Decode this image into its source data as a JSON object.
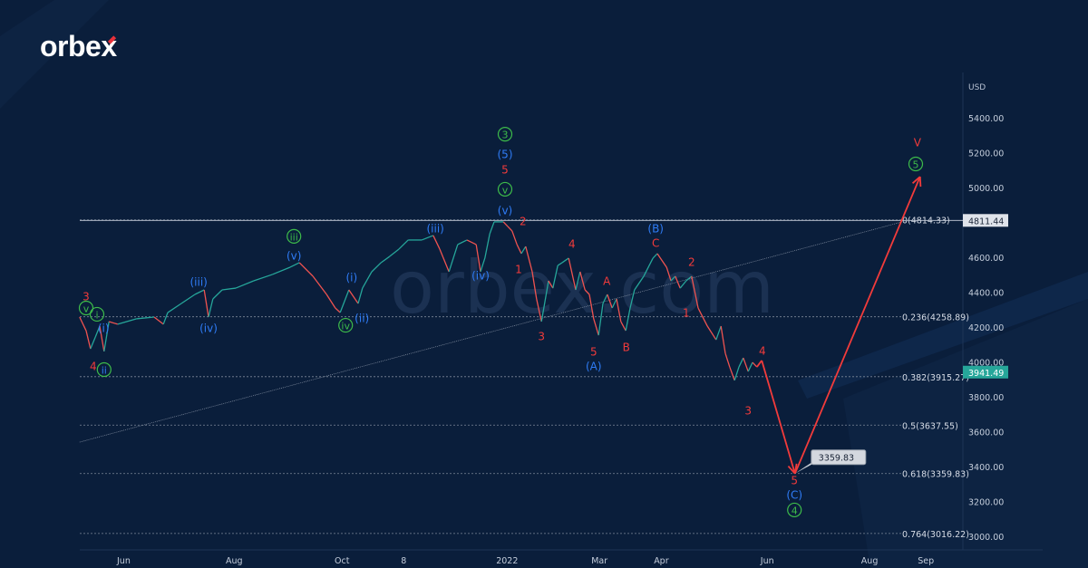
{
  "brand": {
    "logo_text": "orbe",
    "logo_x": "x",
    "watermark": "orbex.com"
  },
  "colors": {
    "background": "#0a1e3b",
    "up": "#26a69a",
    "down": "#ef5350",
    "red": "#f23b3b",
    "blue": "#2f7cf6",
    "green": "#3dbb4a",
    "last_price": "#26a69a"
  },
  "chart_data": {
    "type": "line",
    "title": "",
    "xlabel": "",
    "ylabel": "USD",
    "x_unit": "months since 2021-05-01",
    "ylim": [
      3000,
      5400
    ],
    "xlim": [
      0.18,
      16.3
    ],
    "y_ticks": [
      3000,
      3200,
      3400,
      3600,
      3800,
      4000,
      4200,
      4400,
      4600,
      4800,
      5000,
      5200,
      5400
    ],
    "y_tick_labels": [
      "3000.00",
      "3200.00",
      "3400.00",
      "3600.00",
      "3800.00",
      "4000.00",
      "4200.00",
      "4400.00",
      "4600.00",
      "4800.00",
      "5000.00",
      "5200.00",
      "5400.00"
    ],
    "x_ticks": [
      {
        "m": 1.0,
        "label": "Jun"
      },
      {
        "m": 3.0,
        "label": "Aug"
      },
      {
        "m": 5.0,
        "label": "Oct"
      },
      {
        "m": 6.22,
        "label": "8"
      },
      {
        "m": 7.97,
        "label": "2022"
      },
      {
        "m": 9.72,
        "label": "Mar"
      },
      {
        "m": 10.87,
        "label": "Apr"
      },
      {
        "m": 12.83,
        "label": "Jun"
      },
      {
        "m": 14.68,
        "label": "Aug"
      },
      {
        "m": 15.72,
        "label": "Sep"
      }
    ],
    "series": [
      {
        "name": "Price",
        "points": [
          [
            0.18,
            4257
          ],
          [
            0.3,
            4179
          ],
          [
            0.38,
            4075
          ],
          [
            0.47,
            4143
          ],
          [
            0.55,
            4205
          ],
          [
            0.63,
            4060
          ],
          [
            0.72,
            4231
          ],
          [
            0.88,
            4216
          ],
          [
            1.22,
            4247
          ],
          [
            1.55,
            4257
          ],
          [
            1.72,
            4216
          ],
          [
            1.8,
            4283
          ],
          [
            2.05,
            4335
          ],
          [
            2.3,
            4387
          ],
          [
            2.47,
            4413
          ],
          [
            2.55,
            4257
          ],
          [
            2.63,
            4361
          ],
          [
            2.8,
            4413
          ],
          [
            3.05,
            4423
          ],
          [
            3.38,
            4465
          ],
          [
            3.72,
            4501
          ],
          [
            4.05,
            4543
          ],
          [
            4.22,
            4569
          ],
          [
            4.47,
            4491
          ],
          [
            4.72,
            4387
          ],
          [
            4.88,
            4309
          ],
          [
            4.97,
            4283
          ],
          [
            5.13,
            4413
          ],
          [
            5.3,
            4335
          ],
          [
            5.38,
            4423
          ],
          [
            5.55,
            4517
          ],
          [
            5.72,
            4569
          ],
          [
            5.88,
            4605
          ],
          [
            6.05,
            4647
          ],
          [
            6.22,
            4699
          ],
          [
            6.47,
            4699
          ],
          [
            6.68,
            4725
          ],
          [
            6.8,
            4647
          ],
          [
            6.97,
            4517
          ],
          [
            7.13,
            4673
          ],
          [
            7.3,
            4699
          ],
          [
            7.47,
            4673
          ],
          [
            7.55,
            4517
          ],
          [
            7.63,
            4595
          ],
          [
            7.72,
            4735
          ],
          [
            7.8,
            4803
          ],
          [
            7.97,
            4803
          ],
          [
            8.05,
            4777
          ],
          [
            8.13,
            4751
          ],
          [
            8.22,
            4673
          ],
          [
            8.3,
            4621
          ],
          [
            8.38,
            4662
          ],
          [
            8.5,
            4517
          ],
          [
            8.58,
            4361
          ],
          [
            8.67,
            4231
          ],
          [
            8.8,
            4465
          ],
          [
            8.88,
            4423
          ],
          [
            8.97,
            4553
          ],
          [
            9.05,
            4569
          ],
          [
            9.17,
            4595
          ],
          [
            9.3,
            4413
          ],
          [
            9.38,
            4517
          ],
          [
            9.47,
            4413
          ],
          [
            9.55,
            4387
          ],
          [
            9.63,
            4247
          ],
          [
            9.72,
            4153
          ],
          [
            9.8,
            4335
          ],
          [
            9.88,
            4387
          ],
          [
            9.97,
            4309
          ],
          [
            10.05,
            4361
          ],
          [
            10.13,
            4231
          ],
          [
            10.22,
            4179
          ],
          [
            10.3,
            4309
          ],
          [
            10.38,
            4413
          ],
          [
            10.55,
            4491
          ],
          [
            10.72,
            4595
          ],
          [
            10.8,
            4621
          ],
          [
            10.97,
            4543
          ],
          [
            11.05,
            4465
          ],
          [
            11.13,
            4491
          ],
          [
            11.22,
            4423
          ],
          [
            11.33,
            4465
          ],
          [
            11.43,
            4491
          ],
          [
            11.55,
            4309
          ],
          [
            11.72,
            4205
          ],
          [
            11.88,
            4127
          ],
          [
            11.97,
            4205
          ],
          [
            12.05,
            4049
          ],
          [
            12.13,
            3971
          ],
          [
            12.22,
            3894
          ],
          [
            12.3,
            3971
          ],
          [
            12.38,
            4023
          ],
          [
            12.47,
            3945
          ],
          [
            12.55,
            3997
          ],
          [
            12.63,
            3971
          ]
        ]
      }
    ],
    "projection": {
      "name": "Forecast path",
      "points": [
        [
          12.63,
          3971
        ],
        [
          12.72,
          4008
        ],
        [
          13.33,
          3359.83
        ],
        [
          15.63,
          5062
        ]
      ]
    },
    "trendline": [
      [
        0.18,
        3540
      ],
      [
        15.43,
        4814
      ]
    ],
    "horizontal_line": {
      "price": 4811.44,
      "label": "4811.44"
    },
    "fib_levels": [
      {
        "ratio": "0",
        "price": 4814.33,
        "label": "0(4814.33)"
      },
      {
        "ratio": "0.236",
        "price": 4258.89,
        "label": "0.236(4258.89)"
      },
      {
        "ratio": "0.382",
        "price": 3915.27,
        "label": "0.382(3915.27)"
      },
      {
        "ratio": "0.5",
        "price": 3637.55,
        "label": "0.5(3637.55)"
      },
      {
        "ratio": "0.618",
        "price": 3359.83,
        "label": "0.618(3359.83)"
      },
      {
        "ratio": "0.764",
        "price": 3016.22,
        "label": "0.764(3016.22)"
      }
    ],
    "last_price": {
      "price": 3941.49,
      "label": "3941.49"
    },
    "target_callout": {
      "price": 3359.83,
      "label": "3359.83"
    },
    "wave_labels": [
      {
        "t": "3",
        "c": "red",
        "m": 0.3,
        "p": 4377
      },
      {
        "t": "v",
        "c": "green",
        "circle": true,
        "m": 0.3,
        "p": 4309
      },
      {
        "t": "i",
        "c": "green",
        "circle": true,
        "m": 0.5,
        "p": 4273
      },
      {
        "t": "(i)",
        "c": "blue",
        "m": 0.62,
        "p": 4195
      },
      {
        "t": "4",
        "c": "red",
        "m": 0.43,
        "p": 3977
      },
      {
        "t": "ii",
        "c": "blue",
        "circle": true,
        "m": 0.63,
        "p": 3956
      },
      {
        "t": "(iii)",
        "c": "blue",
        "m": 2.37,
        "p": 4460
      },
      {
        "t": "(iv)",
        "c": "blue",
        "m": 2.55,
        "p": 4195
      },
      {
        "t": "iii",
        "c": "green",
        "circle": true,
        "m": 4.12,
        "p": 4720
      },
      {
        "t": "(v)",
        "c": "blue",
        "m": 4.12,
        "p": 4610
      },
      {
        "t": "(i)",
        "c": "blue",
        "m": 5.18,
        "p": 4486
      },
      {
        "t": "iv",
        "c": "green",
        "circle": true,
        "m": 5.07,
        "p": 4210
      },
      {
        "t": "(ii)",
        "c": "blue",
        "m": 5.37,
        "p": 4252
      },
      {
        "t": "(iii)",
        "c": "blue",
        "m": 6.72,
        "p": 4766
      },
      {
        "t": "(iv)",
        "c": "blue",
        "m": 7.55,
        "p": 4496
      },
      {
        "t": "3",
        "c": "green",
        "circle": true,
        "m": 8.0,
        "p": 5306
      },
      {
        "t": "(5)",
        "c": "blue",
        "m": 8.0,
        "p": 5192
      },
      {
        "t": "5",
        "c": "red",
        "m": 8.0,
        "p": 5104
      },
      {
        "t": "v",
        "c": "green",
        "circle": true,
        "m": 8.0,
        "p": 4990
      },
      {
        "t": "(v)",
        "c": "blue",
        "m": 8.0,
        "p": 4870
      },
      {
        "t": "2",
        "c": "red",
        "m": 8.33,
        "p": 4808
      },
      {
        "t": "1",
        "c": "red",
        "m": 8.25,
        "p": 4532
      },
      {
        "t": "3",
        "c": "red",
        "m": 8.67,
        "p": 4148
      },
      {
        "t": "4",
        "c": "red",
        "m": 9.23,
        "p": 4678
      },
      {
        "t": "A",
        "c": "red",
        "m": 9.87,
        "p": 4465
      },
      {
        "t": "5",
        "c": "red",
        "m": 9.63,
        "p": 4060
      },
      {
        "t": "(A)",
        "c": "blue",
        "m": 9.63,
        "p": 3977
      },
      {
        "t": "B",
        "c": "red",
        "m": 10.23,
        "p": 4086
      },
      {
        "t": "(B)",
        "c": "blue",
        "m": 10.77,
        "p": 4766
      },
      {
        "t": "C",
        "c": "red",
        "m": 10.77,
        "p": 4683
      },
      {
        "t": "2",
        "c": "red",
        "m": 11.43,
        "p": 4574
      },
      {
        "t": "1",
        "c": "red",
        "m": 11.33,
        "p": 4283
      },
      {
        "t": "4",
        "c": "red",
        "m": 12.73,
        "p": 4065
      },
      {
        "t": "3",
        "c": "red",
        "m": 12.47,
        "p": 3722
      },
      {
        "t": "5",
        "c": "red",
        "m": 13.32,
        "p": 3322
      },
      {
        "t": "(C)",
        "c": "blue",
        "m": 13.32,
        "p": 3239
      },
      {
        "t": "4",
        "c": "green",
        "circle": true,
        "m": 13.32,
        "p": 3151
      },
      {
        "t": "V",
        "c": "red",
        "m": 15.58,
        "p": 5260
      },
      {
        "t": "5",
        "c": "green",
        "circle": true,
        "m": 15.55,
        "p": 5135
      }
    ]
  }
}
